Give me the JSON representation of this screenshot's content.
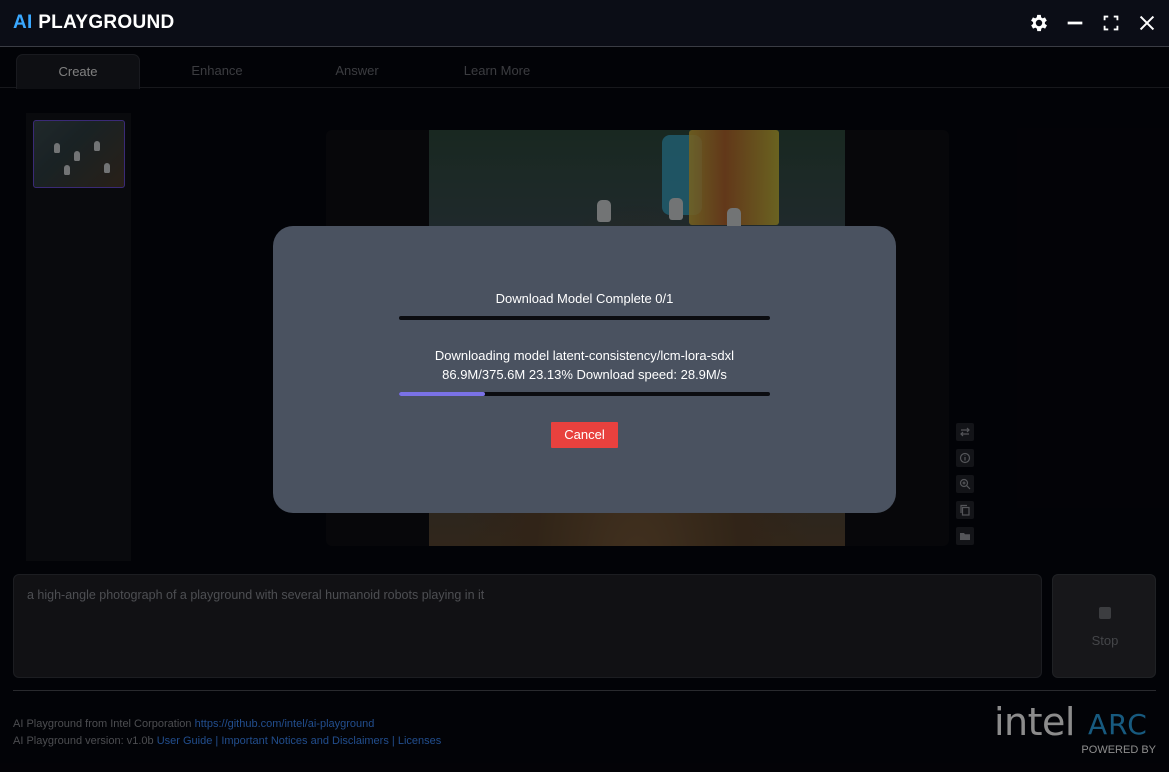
{
  "app": {
    "logo_ai": "AI",
    "logo_rest": "PLAYGROUND"
  },
  "window_controls": [
    "gear-icon",
    "minimize-icon",
    "maximize-icon",
    "close-icon"
  ],
  "tabs": [
    {
      "label": "Create",
      "active": true
    },
    {
      "label": "Enhance",
      "active": false
    },
    {
      "label": "Answer",
      "active": false
    },
    {
      "label": "Learn More",
      "active": false
    }
  ],
  "image_tools": [
    "compare-icon",
    "info-icon",
    "zoom-icon",
    "copy-icon",
    "folder-icon"
  ],
  "prompt": {
    "value": "a high-angle photograph of a playground with several humanoid robots playing in it"
  },
  "stop_button": {
    "label": "Stop"
  },
  "modal": {
    "title": "Download Model Complete 0/1",
    "overall_progress": 0.0,
    "model_line": "Downloading model latent-consistency/lcm-lora-sdxl",
    "stats_line": "86.9M/375.6M 23.13% Download speed: 28.9M/s",
    "file_progress": 0.2313,
    "cancel_label": "Cancel"
  },
  "footer": {
    "line1_text": "AI Playground from Intel Corporation",
    "repo_link": "https://github.com/intel/ai-playground",
    "line2_text": "AI Playground version: v1.0b",
    "user_guide": "User Guide",
    "sep1": " | ",
    "notices": "Important Notices and Disclaimers",
    "sep2": " | ",
    "licenses": "Licenses"
  },
  "brand": {
    "intel": "intel",
    "arc": "ARC",
    "powered_by": "POWERED BY"
  },
  "colors": {
    "accent_blue": "#3aa8ff",
    "cancel_red": "#e8413e",
    "progress_purple": "#7a72e6",
    "link_blue": "#3d8cff"
  }
}
